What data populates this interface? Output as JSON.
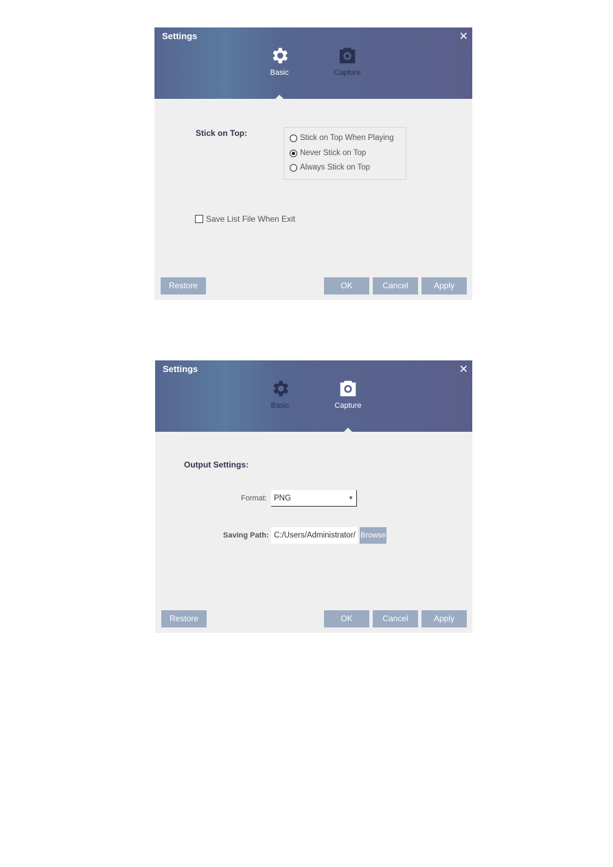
{
  "colors": {
    "header": "#566690",
    "button": "#9babc2",
    "background": "#efefef"
  },
  "windows": [
    {
      "title": "Settings",
      "active_tab": "Basic",
      "tabs": [
        {
          "label": "Basic",
          "icon": "gear-icon"
        },
        {
          "label": "Capture",
          "icon": "camera-icon"
        }
      ],
      "stick_on_top": {
        "label": "Stick on Top:",
        "options": [
          "Stick on Top When Playing",
          "Never Stick on Top",
          "Always Stick on Top"
        ],
        "selected": "Never Stick on Top"
      },
      "save_list": {
        "label": "Save List File When Exit",
        "checked": false
      },
      "buttons": {
        "restore": "Restore",
        "ok": "OK",
        "cancel": "Cancel",
        "apply": "Apply"
      }
    },
    {
      "title": "Settings",
      "active_tab": "Capture",
      "tabs": [
        {
          "label": "Basic",
          "icon": "gear-icon"
        },
        {
          "label": "Capture",
          "icon": "camera-icon"
        }
      ],
      "output": {
        "heading": "Output Settings:",
        "format_label": "Format:",
        "format_value": "PNG",
        "path_label": "Saving Path:",
        "path_value": "C:/Users/Administrator/",
        "browse": "Browse"
      },
      "buttons": {
        "restore": "Restore",
        "ok": "OK",
        "cancel": "Cancel",
        "apply": "Apply"
      }
    }
  ]
}
